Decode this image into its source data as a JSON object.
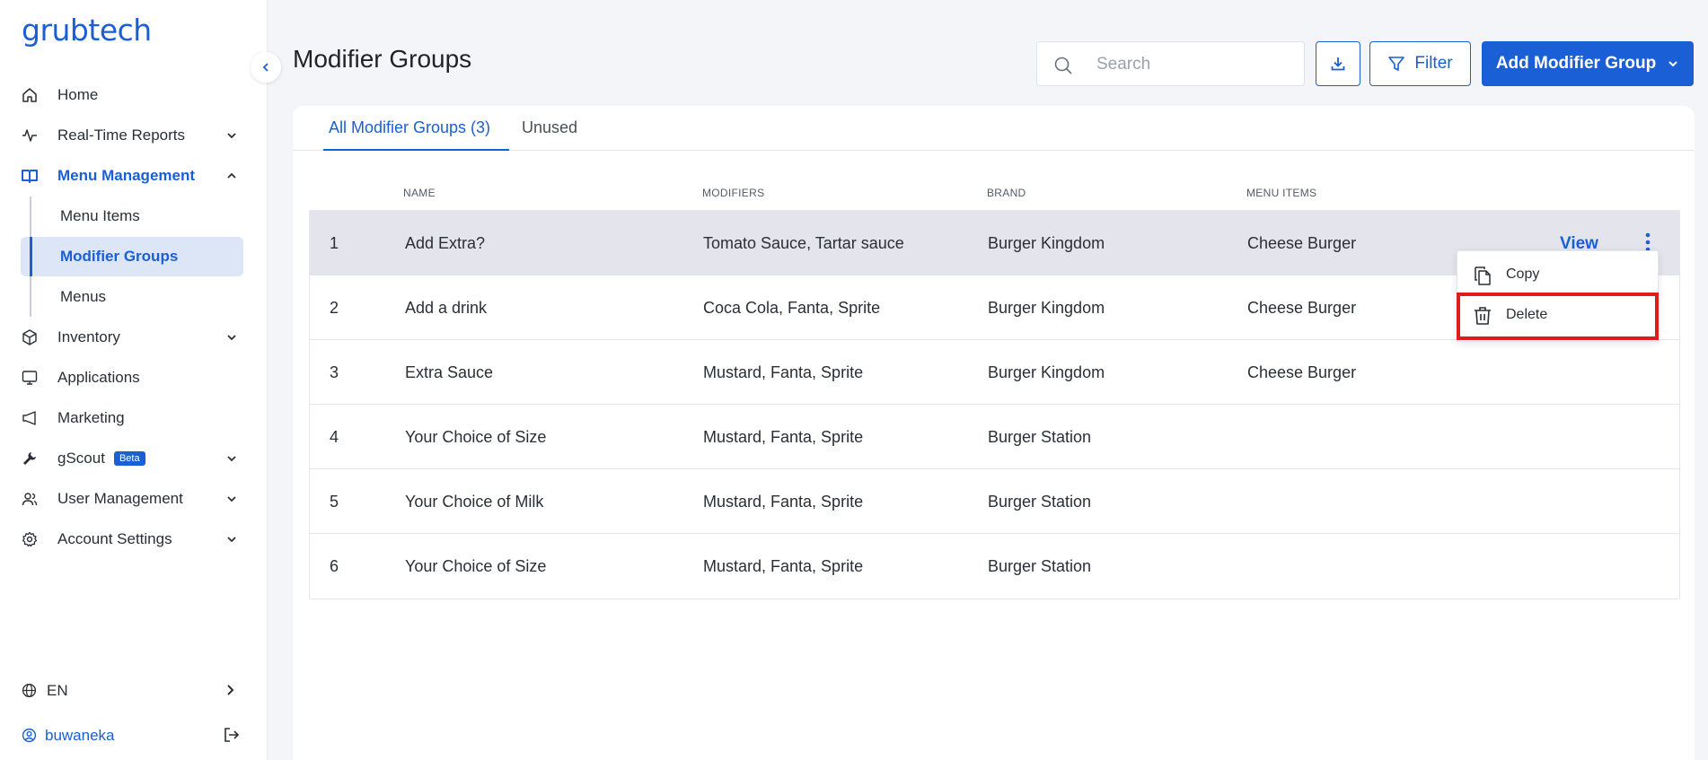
{
  "app": {
    "logo_text": "grubtech"
  },
  "sidebar": {
    "items": [
      {
        "label": "Home",
        "icon": "home-icon"
      },
      {
        "label": "Real-Time Reports",
        "icon": "pulse-icon"
      },
      {
        "label": "Menu Management",
        "icon": "book-icon"
      },
      {
        "label": "Inventory",
        "icon": "box-icon"
      },
      {
        "label": "Applications",
        "icon": "monitor-icon"
      },
      {
        "label": "Marketing",
        "icon": "megaphone-icon"
      },
      {
        "label": "gScout",
        "icon": "wrench-icon",
        "badge": "Beta"
      },
      {
        "label": "User Management",
        "icon": "users-icon"
      },
      {
        "label": "Account Settings",
        "icon": "gear-icon"
      }
    ],
    "sub_items": [
      {
        "label": "Menu Items"
      },
      {
        "label": "Modifier Groups"
      },
      {
        "label": "Menus"
      }
    ],
    "language": "EN",
    "username": "buwaneka"
  },
  "header": {
    "title": "Modifier Groups",
    "search_placeholder": "Search",
    "filter_label": "Filter",
    "add_label": "Add Modifier Group"
  },
  "tabs": [
    {
      "label": "All Modifier Groups (3)"
    },
    {
      "label": "Unused"
    }
  ],
  "table": {
    "columns": [
      "NAME",
      "MODIFIERS",
      "BRAND",
      "MENU ITEMS"
    ],
    "rows": [
      {
        "index": "1",
        "name": "Add Extra?",
        "modifiers": "Tomato Sauce, Tartar sauce",
        "brand": "Burger Kingdom",
        "menu_items": "Cheese Burger"
      },
      {
        "index": "2",
        "name": "Add a drink",
        "modifiers": "Coca Cola, Fanta, Sprite",
        "brand": "Burger Kingdom",
        "menu_items": "Cheese Burger"
      },
      {
        "index": "3",
        "name": "Extra Sauce",
        "modifiers": "Mustard, Fanta, Sprite",
        "brand": "Burger Kingdom",
        "menu_items": "Cheese Burger"
      },
      {
        "index": "4",
        "name": "Your Choice of Size",
        "modifiers": "Mustard, Fanta, Sprite",
        "brand": "Burger Station",
        "menu_items": ""
      },
      {
        "index": "5",
        "name": "Your Choice of Milk",
        "modifiers": "Mustard, Fanta, Sprite",
        "brand": "Burger Station",
        "menu_items": ""
      },
      {
        "index": "6",
        "name": "Your Choice of Size",
        "modifiers": "Mustard, Fanta, Sprite",
        "brand": "Burger Station",
        "menu_items": ""
      }
    ],
    "view_label": "View"
  },
  "context_menu": {
    "items": [
      {
        "label": "Copy",
        "icon": "copy-icon"
      },
      {
        "label": "Delete",
        "icon": "trash-icon"
      }
    ]
  },
  "colors": {
    "accent": "#1a5fd6",
    "highlight": "#e01b1b",
    "selected_row": "#e3e4ec"
  }
}
